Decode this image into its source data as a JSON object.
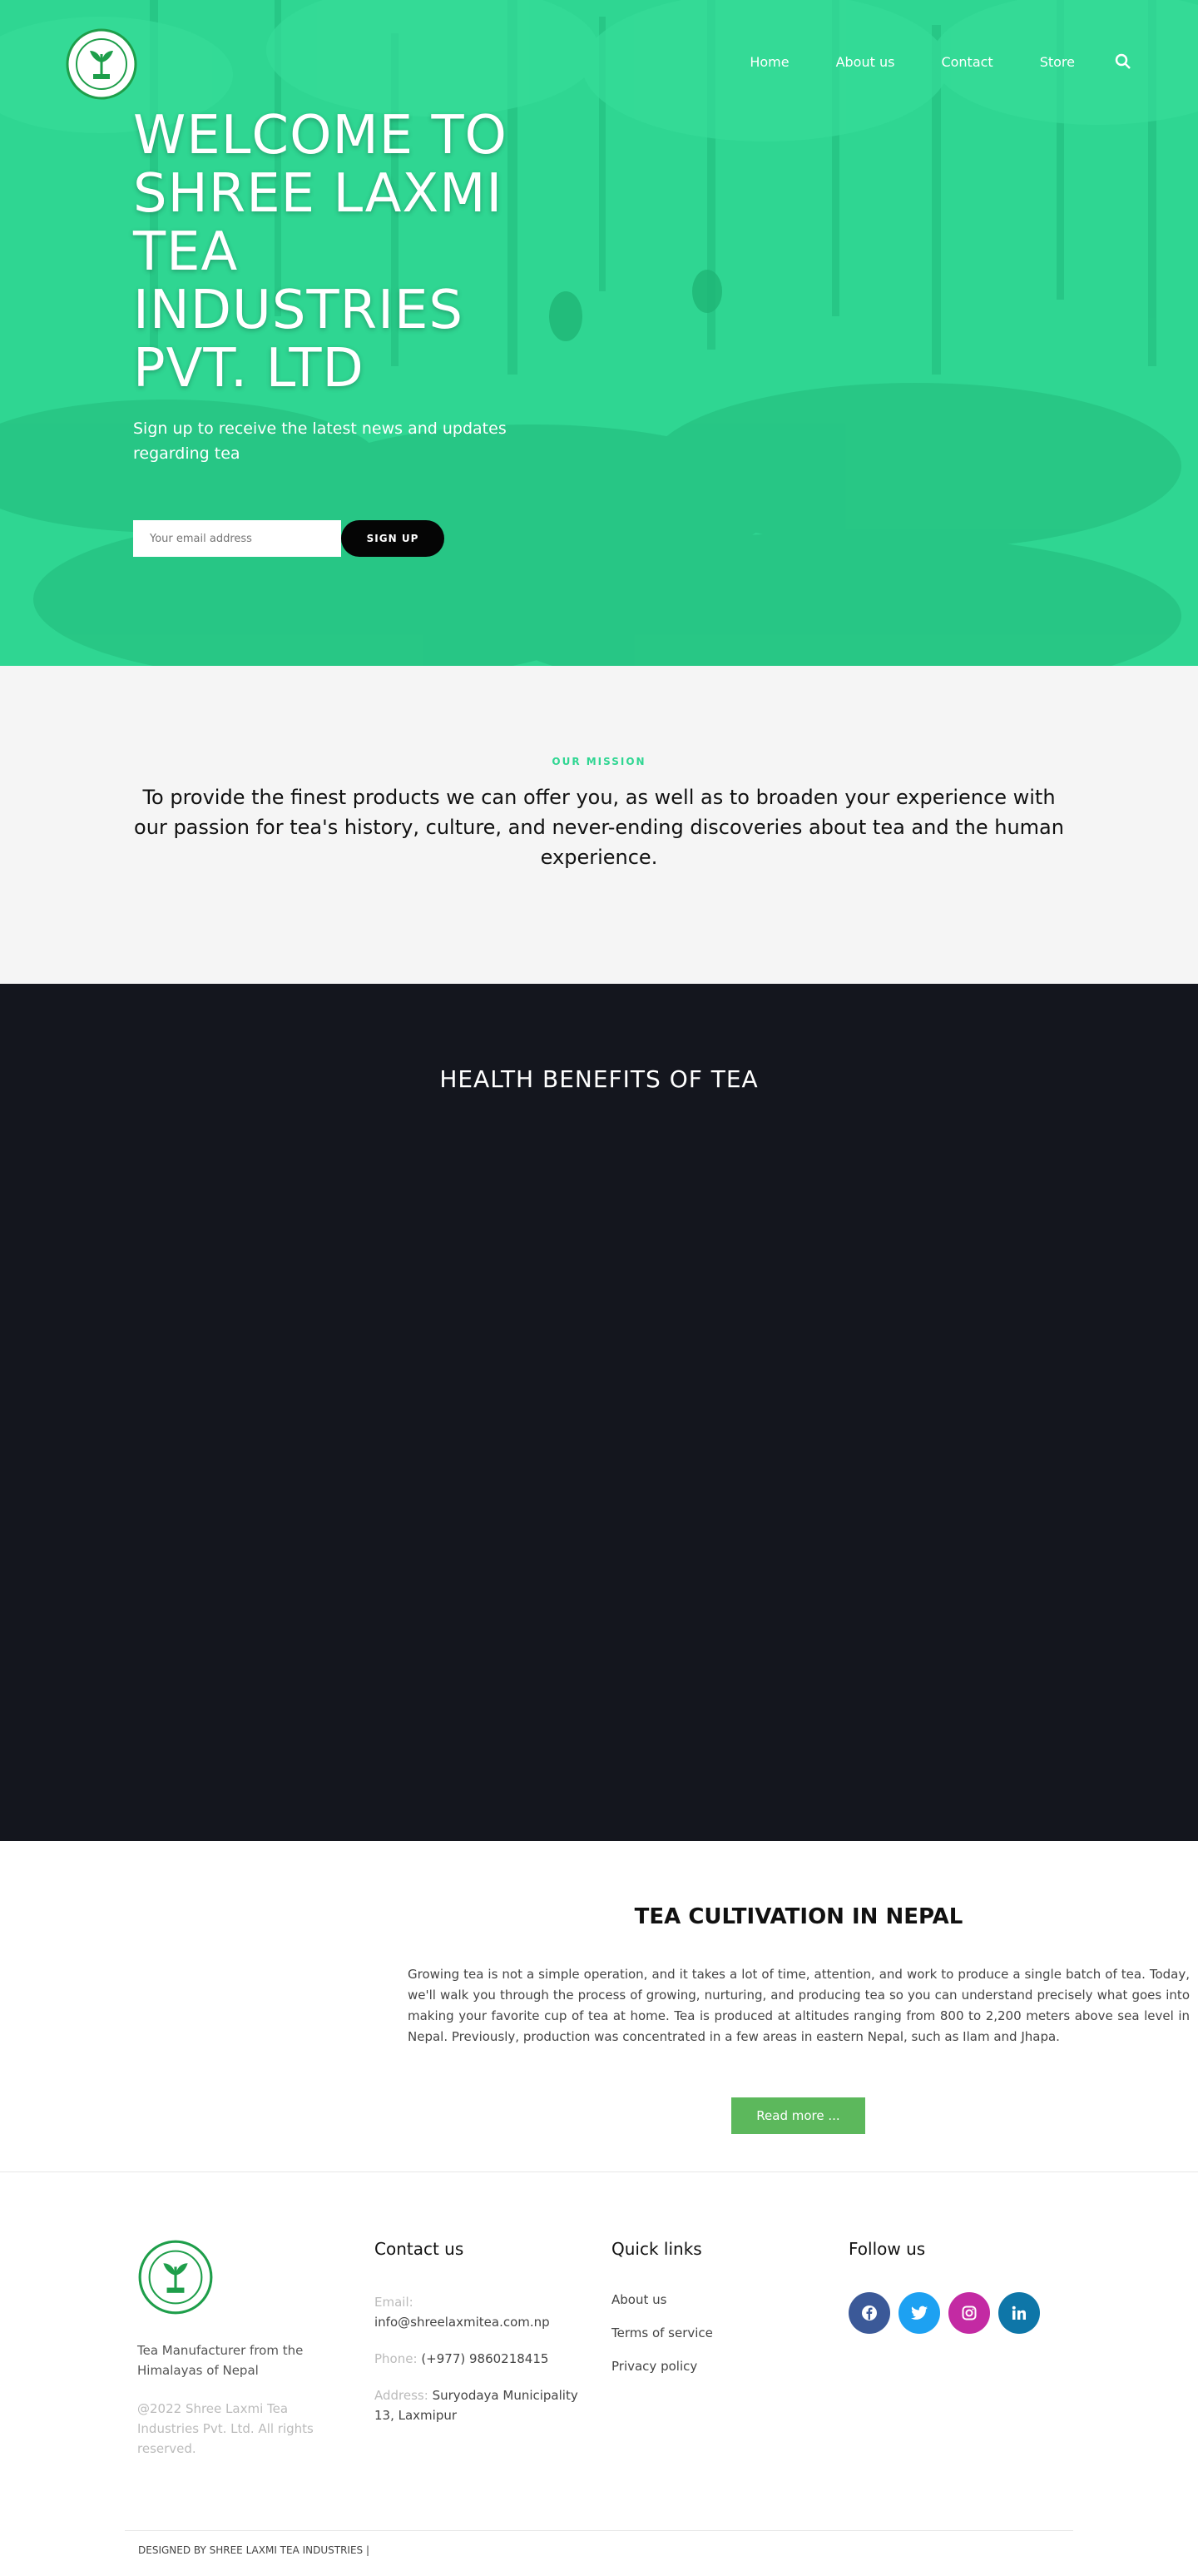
{
  "nav": {
    "links": [
      "Home",
      "About us",
      "Contact",
      "Store"
    ]
  },
  "hero": {
    "title": "WELCOME TO SHREE LAXMI TEA INDUSTRIES PVT. LTD",
    "subtitle": "Sign up to receive the latest news and updates regarding tea",
    "email_placeholder": "Your email address",
    "signup_label": "SIGN UP",
    "overlay_color": "#2fd692"
  },
  "mission": {
    "label": "OUR MISSION",
    "text": "To provide the finest products we can offer you, as well as to broaden your experience with our passion for tea's history, culture, and never-ending discoveries about tea and the human experience."
  },
  "health": {
    "title": "HEALTH BENEFITS OF TEA"
  },
  "cultivation": {
    "title": "TEA CULTIVATION IN NEPAL",
    "text": "Growing tea is not a simple operation, and it takes a lot of time, attention, and work to produce a single batch of tea. Today, we'll walk you through the process of growing, nurturing, and producing tea so you can understand precisely what goes into making your favorite cup of tea at home. Tea is produced at altitudes ranging from 800 to 2,200 meters above sea level in Nepal. Previously, production was concentrated in a few areas in eastern Nepal, such as Ilam and Jhapa.",
    "button": "Read more ..."
  },
  "footer": {
    "tagline": "Tea Manufacturer from the Himalayas of Nepal",
    "copyright": "@2022 Shree Laxmi Tea Industries Pvt. Ltd. All rights reserved.",
    "contact": {
      "heading": "Contact us",
      "email_label": "Email:",
      "email": "info@shreelaxmitea.com.np",
      "phone_label": "Phone:",
      "phone": "(+977) 9860218415",
      "address_label": "Address:",
      "address": "Suryodaya Municipality 13, Laxmipur"
    },
    "quick_links": {
      "heading": "Quick links",
      "items": [
        "About us",
        "Terms of service",
        "Privacy policy"
      ]
    },
    "follow": {
      "heading": "Follow us",
      "networks": [
        {
          "icon": "facebook-icon",
          "color": "#3b5998"
        },
        {
          "icon": "twitter-icon",
          "color": "#1da1f2"
        },
        {
          "icon": "instagram-icon",
          "color": "#c32aa3"
        },
        {
          "icon": "linkedin-icon",
          "color": "#0e76a8"
        }
      ]
    },
    "designed_by": "DESIGNED BY SHREE LAXMI TEA INDUSTRIES |"
  }
}
